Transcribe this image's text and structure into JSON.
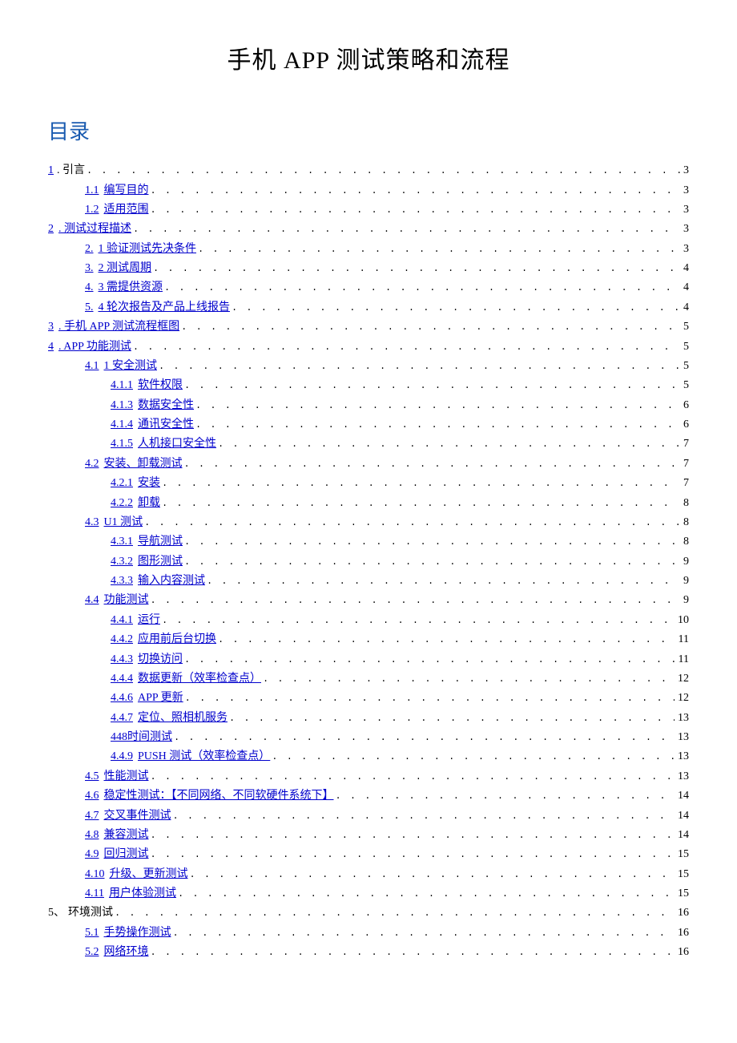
{
  "title": "手机 APP 测试策略和流程",
  "toc_heading": "目录",
  "toc": [
    {
      "num": "1",
      "label": ". 引言",
      "page": "3",
      "lvl": 0,
      "linkNum": true,
      "plainLabel": true
    },
    {
      "num": "1.1",
      "label": "编写目的",
      "page": "3",
      "lvl": 1
    },
    {
      "num": "1.2",
      "label": "适用范围",
      "page": "3",
      "lvl": 1
    },
    {
      "num": "2",
      "label": ". 测试过程描述",
      "page": "3",
      "lvl": 0,
      "linkNum": true
    },
    {
      "num": "2.",
      "label": "1 验证测试先决条件",
      "page": "3",
      "lvl": 1
    },
    {
      "num": "3.",
      "label": "2 测试周期",
      "page": "4",
      "lvl": 1
    },
    {
      "num": "4.",
      "label": "3 需提供资源",
      "page": "4",
      "lvl": 1
    },
    {
      "num": "5.",
      "label": "4 轮次报告及产品上线报告",
      "page": "4",
      "lvl": 1
    },
    {
      "num": "3",
      "label": ". 手机 APP 测试流程框图",
      "page": "5",
      "lvl": 0,
      "linkNum": true
    },
    {
      "num": "4",
      "label": ". APP 功能测试",
      "page": "5",
      "lvl": 0,
      "linkNum": true
    },
    {
      "num": "4.1",
      "label": "1 安全测试",
      "page": "5",
      "lvl": 1
    },
    {
      "num": "4.1.1",
      "label": "软件权限",
      "page": "5",
      "lvl": 2
    },
    {
      "num": "4.1.3",
      "label": "数据安全性",
      "page": "6",
      "lvl": 2
    },
    {
      "num": "4.1.4",
      "label": "通讯安全性",
      "page": "6",
      "lvl": 2
    },
    {
      "num": "4.1.5",
      "label": "人机接口安全性",
      "page": "7",
      "lvl": 2
    },
    {
      "num": "4.2",
      "label": "安装、卸载测试",
      "page": "7",
      "lvl": 1
    },
    {
      "num": "4.2.1",
      "label": "安装",
      "page": "7",
      "lvl": 2
    },
    {
      "num": "4.2.2",
      "label": "卸载",
      "page": "8",
      "lvl": 2
    },
    {
      "num": "4.3",
      "label": "U1 测试",
      "page": "8",
      "lvl": 1
    },
    {
      "num": "4.3.1",
      "label": "导航测试",
      "page": "8",
      "lvl": 2
    },
    {
      "num": "4.3.2",
      "label": "图形测试",
      "page": "9",
      "lvl": 2
    },
    {
      "num": "4.3.3",
      "label": "输入内容测试",
      "page": "9",
      "lvl": 2
    },
    {
      "num": "4.4",
      "label": "功能测试",
      "page": "9",
      "lvl": 1
    },
    {
      "num": "4.4.1",
      "label": "运行",
      "page": "10",
      "lvl": 2
    },
    {
      "num": "4.4.2",
      "label": "应用前后台切换",
      "page": "11",
      "lvl": 2
    },
    {
      "num": "4.4.3",
      "label": "切换访问",
      "page": "11",
      "lvl": 2
    },
    {
      "num": "4.4.4",
      "label": "数据更新（效率检查点）",
      "page": "12",
      "lvl": 2
    },
    {
      "num": "4.4.6",
      "label": "APP 更新",
      "page": "12",
      "lvl": 2
    },
    {
      "num": "4.4.7",
      "label": "定位、照相机服务",
      "page": "13",
      "lvl": 2
    },
    {
      "num": "448",
      "label": "时间测试",
      "page": "13",
      "lvl": 2,
      "joinLabel": true
    },
    {
      "num": "4.4.9",
      "label": "PUSH 测试（效率检查点）",
      "page": "13",
      "lvl": 2
    },
    {
      "num": "4.5",
      "label": "性能测试",
      "page": "13",
      "lvl": 1
    },
    {
      "num": "4.6",
      "label": "稳定性测试：【不同网络、不同软硬件系统下】",
      "page": "14",
      "lvl": 1
    },
    {
      "num": "4.7",
      "label": "交叉事件测试",
      "page": "14",
      "lvl": 1
    },
    {
      "num": "4.8",
      "label": "兼容测试",
      "page": "14",
      "lvl": 1
    },
    {
      "num": "4.9",
      "label": "回归测试",
      "page": "15",
      "lvl": 1
    },
    {
      "num": "4.10",
      "label": " 升级、更新测试",
      "page": "15",
      "lvl": 1
    },
    {
      "num": "4.11",
      "label": " 用户体验测试",
      "page": "15",
      "lvl": 1
    },
    {
      "num": "5、",
      "label": "环境测试",
      "page": "16",
      "lvl": 0,
      "plainNum": true,
      "plainLabel": true
    },
    {
      "num": "5.1",
      "label": "手势操作测试",
      "page": "16",
      "lvl": 1
    },
    {
      "num": "5.2",
      "label": "网络环境",
      "page": "16",
      "lvl": 1
    }
  ]
}
